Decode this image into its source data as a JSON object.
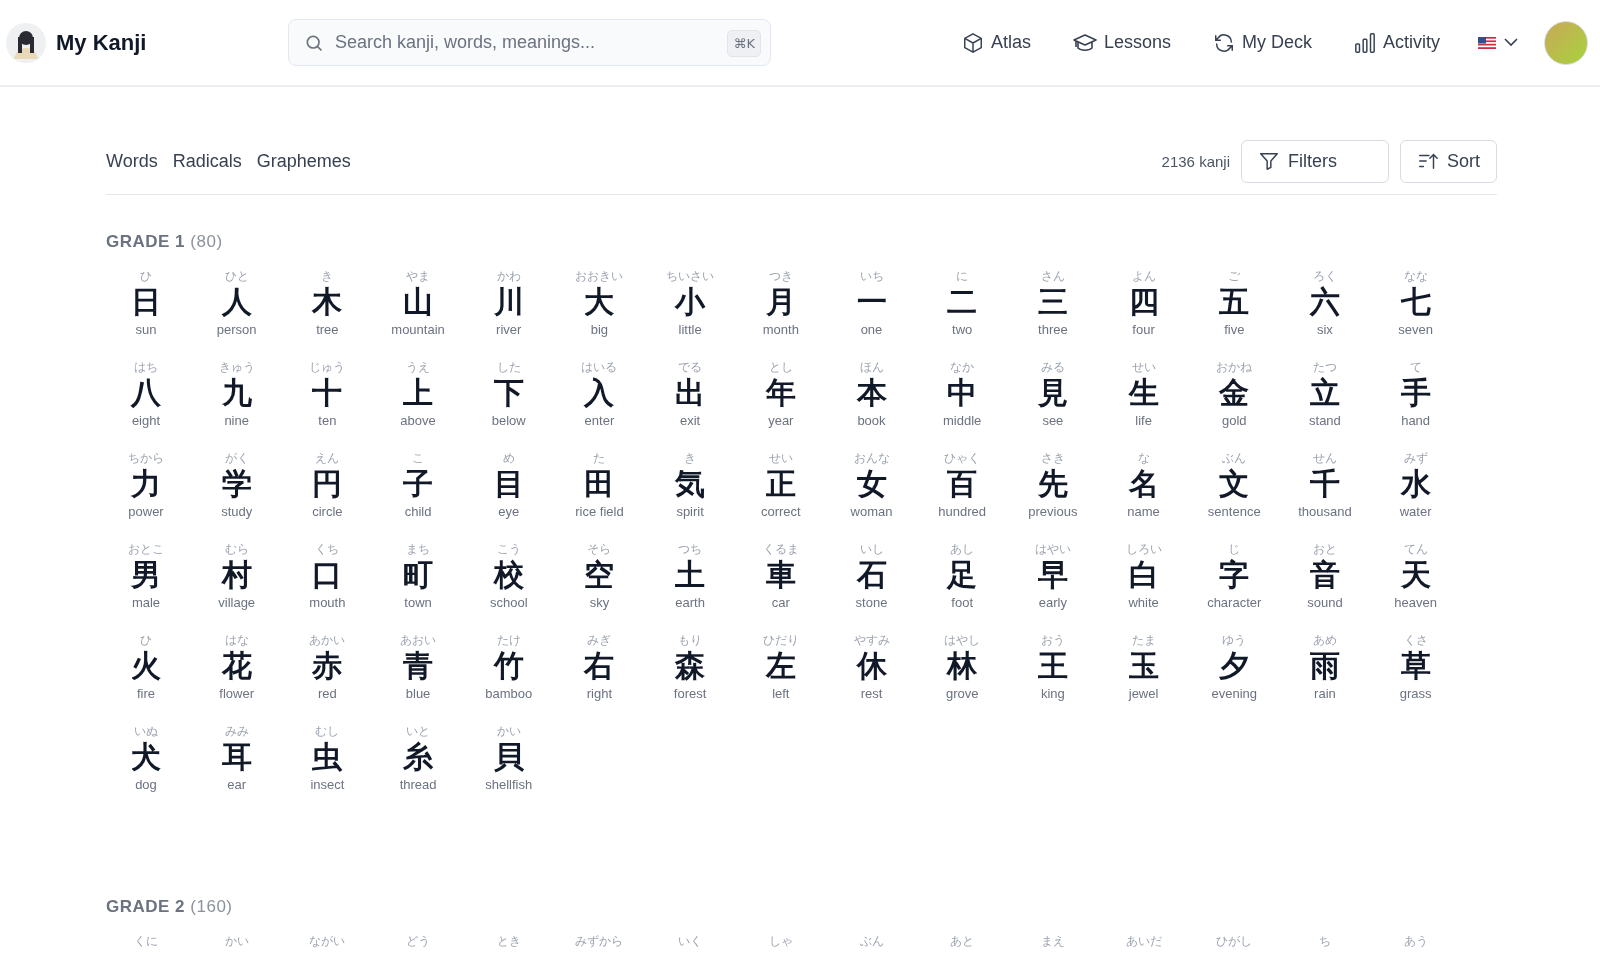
{
  "header": {
    "app_name": "My Kanji",
    "search": {
      "placeholder": "Search kanji, words, meanings...",
      "shortcut": "⌘K"
    },
    "nav": [
      {
        "kind": "atlas",
        "label": "Atlas"
      },
      {
        "kind": "lessons",
        "label": "Lessons"
      },
      {
        "kind": "deck",
        "label": "My Deck"
      },
      {
        "kind": "activity",
        "label": "Activity"
      }
    ]
  },
  "tabs": [
    {
      "label": "Words"
    },
    {
      "label": "Radicals"
    },
    {
      "label": "Graphemes"
    }
  ],
  "count": "2136 kanji",
  "buttons": [
    {
      "kind": "filter",
      "label": "Filters"
    },
    {
      "kind": "sort",
      "label": "Sort"
    }
  ],
  "grades": [
    {
      "title": "GRADE 1",
      "count": "(80)",
      "kanji": [
        {
          "reading": "ひ",
          "kanji": "日",
          "meaning": "sun"
        },
        {
          "reading": "ひと",
          "kanji": "人",
          "meaning": "person"
        },
        {
          "reading": "き",
          "kanji": "木",
          "meaning": "tree"
        },
        {
          "reading": "やま",
          "kanji": "山",
          "meaning": "mountain"
        },
        {
          "reading": "かわ",
          "kanji": "川",
          "meaning": "river"
        },
        {
          "reading": "おおきい",
          "kanji": "大",
          "meaning": "big"
        },
        {
          "reading": "ちいさい",
          "kanji": "小",
          "meaning": "little"
        },
        {
          "reading": "つき",
          "kanji": "月",
          "meaning": "month"
        },
        {
          "reading": "いち",
          "kanji": "一",
          "meaning": "one"
        },
        {
          "reading": "に",
          "kanji": "二",
          "meaning": "two"
        },
        {
          "reading": "さん",
          "kanji": "三",
          "meaning": "three"
        },
        {
          "reading": "よん",
          "kanji": "四",
          "meaning": "four"
        },
        {
          "reading": "ご",
          "kanji": "五",
          "meaning": "five"
        },
        {
          "reading": "ろく",
          "kanji": "六",
          "meaning": "six"
        },
        {
          "reading": "なな",
          "kanji": "七",
          "meaning": "seven"
        },
        {
          "reading": "はち",
          "kanji": "八",
          "meaning": "eight"
        },
        {
          "reading": "きゅう",
          "kanji": "九",
          "meaning": "nine"
        },
        {
          "reading": "じゅう",
          "kanji": "十",
          "meaning": "ten"
        },
        {
          "reading": "うえ",
          "kanji": "上",
          "meaning": "above"
        },
        {
          "reading": "した",
          "kanji": "下",
          "meaning": "below"
        },
        {
          "reading": "はいる",
          "kanji": "入",
          "meaning": "enter"
        },
        {
          "reading": "でる",
          "kanji": "出",
          "meaning": "exit"
        },
        {
          "reading": "とし",
          "kanji": "年",
          "meaning": "year"
        },
        {
          "reading": "ほん",
          "kanji": "本",
          "meaning": "book"
        },
        {
          "reading": "なか",
          "kanji": "中",
          "meaning": "middle"
        },
        {
          "reading": "みる",
          "kanji": "見",
          "meaning": "see"
        },
        {
          "reading": "せい",
          "kanji": "生",
          "meaning": "life"
        },
        {
          "reading": "おかね",
          "kanji": "金",
          "meaning": "gold"
        },
        {
          "reading": "たつ",
          "kanji": "立",
          "meaning": "stand"
        },
        {
          "reading": "て",
          "kanji": "手",
          "meaning": "hand"
        },
        {
          "reading": "ちから",
          "kanji": "力",
          "meaning": "power"
        },
        {
          "reading": "がく",
          "kanji": "学",
          "meaning": "study"
        },
        {
          "reading": "えん",
          "kanji": "円",
          "meaning": "circle"
        },
        {
          "reading": "こ",
          "kanji": "子",
          "meaning": "child"
        },
        {
          "reading": "め",
          "kanji": "目",
          "meaning": "eye"
        },
        {
          "reading": "た",
          "kanji": "田",
          "meaning": "rice field"
        },
        {
          "reading": "き",
          "kanji": "気",
          "meaning": "spirit"
        },
        {
          "reading": "せい",
          "kanji": "正",
          "meaning": "correct"
        },
        {
          "reading": "おんな",
          "kanji": "女",
          "meaning": "woman"
        },
        {
          "reading": "ひゃく",
          "kanji": "百",
          "meaning": "hundred"
        },
        {
          "reading": "さき",
          "kanji": "先",
          "meaning": "previous"
        },
        {
          "reading": "な",
          "kanji": "名",
          "meaning": "name"
        },
        {
          "reading": "ぶん",
          "kanji": "文",
          "meaning": "sentence"
        },
        {
          "reading": "せん",
          "kanji": "千",
          "meaning": "thousand"
        },
        {
          "reading": "みず",
          "kanji": "水",
          "meaning": "water"
        },
        {
          "reading": "おとこ",
          "kanji": "男",
          "meaning": "male"
        },
        {
          "reading": "むら",
          "kanji": "村",
          "meaning": "village"
        },
        {
          "reading": "くち",
          "kanji": "口",
          "meaning": "mouth"
        },
        {
          "reading": "まち",
          "kanji": "町",
          "meaning": "town"
        },
        {
          "reading": "こう",
          "kanji": "校",
          "meaning": "school"
        },
        {
          "reading": "そら",
          "kanji": "空",
          "meaning": "sky"
        },
        {
          "reading": "つち",
          "kanji": "土",
          "meaning": "earth"
        },
        {
          "reading": "くるま",
          "kanji": "車",
          "meaning": "car"
        },
        {
          "reading": "いし",
          "kanji": "石",
          "meaning": "stone"
        },
        {
          "reading": "あし",
          "kanji": "足",
          "meaning": "foot"
        },
        {
          "reading": "はやい",
          "kanji": "早",
          "meaning": "early"
        },
        {
          "reading": "しろい",
          "kanji": "白",
          "meaning": "white"
        },
        {
          "reading": "じ",
          "kanji": "字",
          "meaning": "character"
        },
        {
          "reading": "おと",
          "kanji": "音",
          "meaning": "sound"
        },
        {
          "reading": "てん",
          "kanji": "天",
          "meaning": "heaven"
        },
        {
          "reading": "ひ",
          "kanji": "火",
          "meaning": "fire"
        },
        {
          "reading": "はな",
          "kanji": "花",
          "meaning": "flower"
        },
        {
          "reading": "あかい",
          "kanji": "赤",
          "meaning": "red"
        },
        {
          "reading": "あおい",
          "kanji": "青",
          "meaning": "blue"
        },
        {
          "reading": "たけ",
          "kanji": "竹",
          "meaning": "bamboo"
        },
        {
          "reading": "みぎ",
          "kanji": "右",
          "meaning": "right"
        },
        {
          "reading": "もり",
          "kanji": "森",
          "meaning": "forest"
        },
        {
          "reading": "ひだり",
          "kanji": "左",
          "meaning": "left"
        },
        {
          "reading": "やすみ",
          "kanji": "休",
          "meaning": "rest"
        },
        {
          "reading": "はやし",
          "kanji": "林",
          "meaning": "grove"
        },
        {
          "reading": "おう",
          "kanji": "王",
          "meaning": "king"
        },
        {
          "reading": "たま",
          "kanji": "玉",
          "meaning": "jewel"
        },
        {
          "reading": "ゆう",
          "kanji": "夕",
          "meaning": "evening"
        },
        {
          "reading": "あめ",
          "kanji": "雨",
          "meaning": "rain"
        },
        {
          "reading": "くさ",
          "kanji": "草",
          "meaning": "grass"
        },
        {
          "reading": "いぬ",
          "kanji": "犬",
          "meaning": "dog"
        },
        {
          "reading": "みみ",
          "kanji": "耳",
          "meaning": "ear"
        },
        {
          "reading": "むし",
          "kanji": "虫",
          "meaning": "insect"
        },
        {
          "reading": "いと",
          "kanji": "糸",
          "meaning": "thread"
        },
        {
          "reading": "かい",
          "kanji": "貝",
          "meaning": "shellfish"
        }
      ]
    },
    {
      "title": "GRADE 2",
      "count": "(160)",
      "kanji": [
        {
          "reading": "くに"
        },
        {
          "reading": "かい"
        },
        {
          "reading": "ながい"
        },
        {
          "reading": "どう"
        },
        {
          "reading": "とき"
        },
        {
          "reading": "みずから"
        },
        {
          "reading": "いく"
        },
        {
          "reading": "しゃ"
        },
        {
          "reading": "ぶん"
        },
        {
          "reading": "あと"
        },
        {
          "reading": "まえ"
        },
        {
          "reading": "あいだ"
        },
        {
          "reading": "ひがし"
        },
        {
          "reading": "ち"
        },
        {
          "reading": "あう"
        }
      ]
    }
  ]
}
